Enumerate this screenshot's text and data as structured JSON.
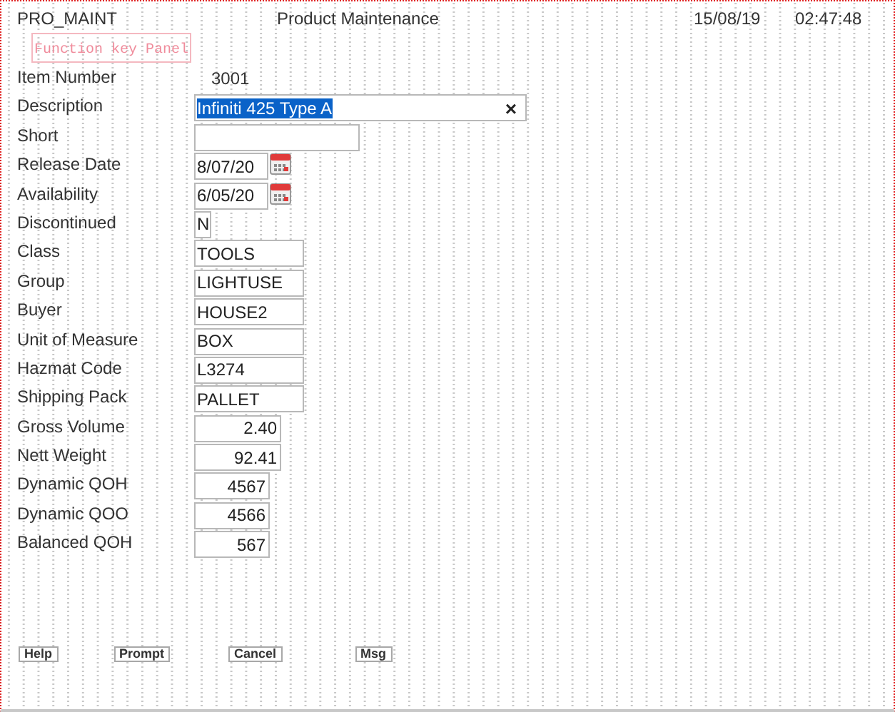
{
  "header": {
    "program": "PRO_MAINT",
    "title": "Product Maintenance",
    "date": "15/08/19",
    "time": "02:47:48"
  },
  "overlay": {
    "label": "Function key Panel"
  },
  "fields": [
    {
      "label": "Item Number",
      "kind": "display",
      "value": "3001"
    },
    {
      "label": "Description",
      "kind": "long",
      "value": "Infiniti 425 Type A",
      "selected": true,
      "clear": "×"
    },
    {
      "label": "Short",
      "kind": "short"
    },
    {
      "label": "Release Date",
      "kind": "date",
      "value": "8/07/20"
    },
    {
      "label": "Availability",
      "kind": "date",
      "value": "6/05/20"
    },
    {
      "label": "Discontinued",
      "kind": "flag",
      "value": "N"
    },
    {
      "label": "Class",
      "kind": "code",
      "value": "TOOLS"
    },
    {
      "label": "Group",
      "kind": "code",
      "value": "LIGHTUSE"
    },
    {
      "label": "Buyer",
      "kind": "code",
      "value": "HOUSE2"
    },
    {
      "label": "Unit of Measure",
      "kind": "code",
      "value": "BOX"
    },
    {
      "label": "Hazmat Code",
      "kind": "code",
      "value": "L3274"
    },
    {
      "label": "Shipping Pack",
      "kind": "code",
      "value": "PALLET"
    },
    {
      "label": "Gross Volume",
      "kind": "decimal",
      "value": "2.40"
    },
    {
      "label": "Nett Weight",
      "kind": "decimal",
      "value": "92.41"
    },
    {
      "label": "Dynamic QOH",
      "kind": "integer",
      "value": "4567"
    },
    {
      "label": "Dynamic QOO",
      "kind": "integer",
      "value": "4566"
    },
    {
      "label": "Balanced QOH",
      "kind": "integer",
      "value": "567"
    }
  ],
  "buttons": [
    {
      "label": "Help"
    },
    {
      "label": "Prompt"
    },
    {
      "label": "Cancel"
    },
    {
      "label": "Msg"
    }
  ]
}
